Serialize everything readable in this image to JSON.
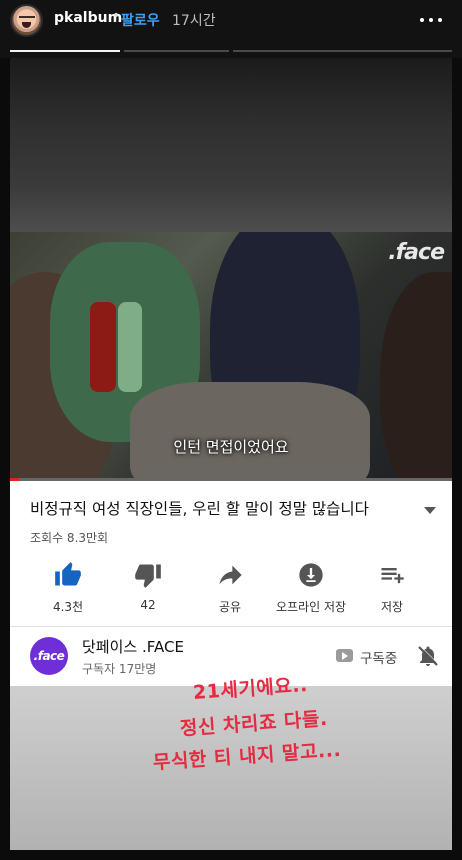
{
  "story": {
    "username": "pkalbum",
    "separator": "•",
    "follow_label": "팔로우",
    "time_ago": "17시간",
    "more_icon": "more-horizontal-icon",
    "segments": [
      {
        "state": "done"
      },
      {
        "state": "current"
      },
      {
        "state": "pending"
      }
    ]
  },
  "video": {
    "watermark": ".face",
    "subtitle": "인턴 면접이었어요",
    "progress_percent": 2
  },
  "info": {
    "title": "비정규직 여성 직장인들, 우린 할 말이 정말 많습니다",
    "views": "조회수 8.3만회",
    "actions": [
      {
        "icon": "thumbs-up-icon",
        "label": "4.3천"
      },
      {
        "icon": "thumbs-down-icon",
        "label": "42"
      },
      {
        "icon": "share-icon",
        "label": "공유"
      },
      {
        "icon": "download-icon",
        "label": "오프라인 저장"
      },
      {
        "icon": "playlist-add-icon",
        "label": "저장"
      }
    ]
  },
  "channel": {
    "avatar_text": ".face",
    "name": "닷페이스 .FACE",
    "subscribers": "구독자 17만명",
    "subscribed_label": "구독중",
    "accent_color": "#6f2fd8"
  },
  "caption": {
    "lines": [
      "21세기에요..",
      "정신 차리죠 다들.",
      "무식한 티 내지 말고..."
    ],
    "color": "#e52b41"
  },
  "colors": {
    "follow": "#3ea0f5",
    "like_active": "#1565c0",
    "progress_red": "#e62117"
  }
}
